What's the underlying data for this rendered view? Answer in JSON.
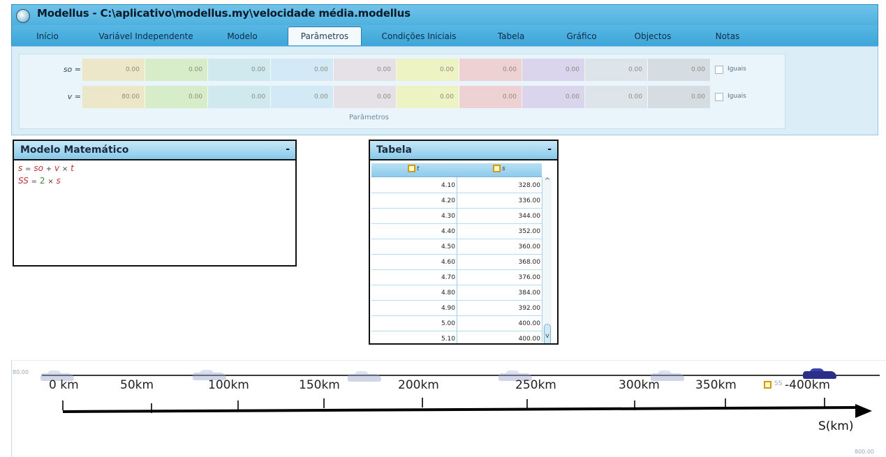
{
  "window": {
    "title": "Modellus - C:\\aplicativo\\modellus.my\\velocidade média.modellus"
  },
  "tabs": [
    {
      "label": "Início"
    },
    {
      "label": "Variável Independente"
    },
    {
      "label": "Modelo"
    },
    {
      "label": "Parâmetros",
      "active": true
    },
    {
      "label": "Condições Iniciais"
    },
    {
      "label": "Tabela"
    },
    {
      "label": "Gráfico"
    },
    {
      "label": "Objectos"
    },
    {
      "label": "Notas"
    }
  ],
  "parameters": {
    "rows": [
      {
        "label": "so =",
        "values": [
          "0.00",
          "0.00",
          "0.00",
          "0.00",
          "0.00",
          "0.00",
          "0.00",
          "0.00",
          "0.00",
          "0.00"
        ],
        "equal_label": "Iguais"
      },
      {
        "label": "v =",
        "values": [
          "80.00",
          "0.00",
          "0.00",
          "0.00",
          "0.00",
          "0.00",
          "0.00",
          "0.00",
          "0.00",
          "0.00"
        ],
        "equal_label": "Iguais"
      }
    ],
    "cell_colors": [
      "#ece7c8",
      "#d7ecc8",
      "#cfe9ee",
      "#d3e9f6",
      "#e6e1e6",
      "#eef3c4",
      "#eed1d2",
      "#dad4ec",
      "#dde5ea",
      "#d6dde2"
    ],
    "caption": "Parâmetros"
  },
  "model_panel": {
    "title": "Modelo Matemático",
    "minimize": "-",
    "equations": [
      {
        "lhs": "s",
        "eq": "=",
        "t1": "so",
        "op1": "+",
        "t2": "v",
        "op2": "×",
        "t3": "t"
      },
      {
        "lhs": "SS",
        "eq": "=",
        "t1": "2",
        "op1": "×",
        "t2": "s"
      }
    ]
  },
  "table_panel": {
    "title": "Tabela",
    "minimize": "-",
    "columns": [
      "t",
      "s"
    ],
    "rows": [
      [
        "4.10",
        "328.00"
      ],
      [
        "4.20",
        "336.00"
      ],
      [
        "4.30",
        "344.00"
      ],
      [
        "4.40",
        "352.00"
      ],
      [
        "4.50",
        "360.00"
      ],
      [
        "4.60",
        "368.00"
      ],
      [
        "4.70",
        "376.00"
      ],
      [
        "4.80",
        "384.00"
      ],
      [
        "4.90",
        "392.00"
      ],
      [
        "5.00",
        "400.00"
      ],
      [
        "5.10",
        "400.00"
      ]
    ],
    "scroll_up": "^",
    "scroll_down": "v"
  },
  "animation": {
    "corner_top_left": "80.00",
    "corner_bottom_right": "800.00",
    "scale_labels": [
      "0 km",
      "50km",
      "100km",
      "150km",
      "200km",
      "250km",
      "300km",
      "350km",
      "-400km"
    ],
    "ss_label": "SS",
    "axis_label": "S(km)"
  }
}
